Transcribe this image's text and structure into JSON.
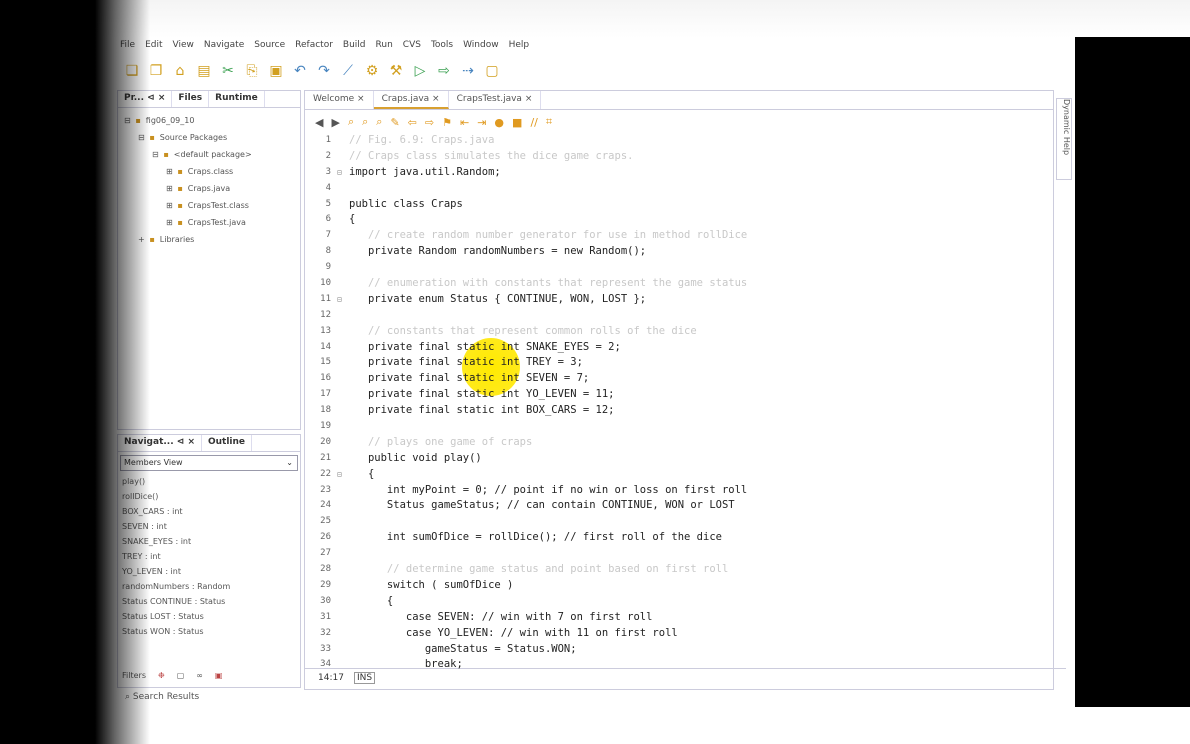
{
  "menu": [
    "File",
    "Edit",
    "View",
    "Navigate",
    "Source",
    "Refactor",
    "Build",
    "Run",
    "CVS",
    "Tools",
    "Window",
    "Help"
  ],
  "projects_panel": {
    "tabs": [
      "Pr... ⊲ ×",
      "Files",
      "Runtime"
    ],
    "tree": [
      {
        "indent": 0,
        "label": "fig06_09_10"
      },
      {
        "indent": 1,
        "label": "Source Packages"
      },
      {
        "indent": 2,
        "label": "<default package>"
      },
      {
        "indent": 3,
        "label": "Craps.class"
      },
      {
        "indent": 3,
        "label": "Craps.java"
      },
      {
        "indent": 3,
        "label": "CrapsTest.class"
      },
      {
        "indent": 3,
        "label": "CrapsTest.java"
      },
      {
        "indent": 1,
        "label": "Libraries"
      }
    ]
  },
  "navigator_panel": {
    "tabs": [
      "Navigat... ⊲ ×",
      "Outline"
    ],
    "view": "Members View",
    "members": [
      "play()",
      "rollDice()",
      "BOX_CARS : int",
      "SEVEN : int",
      "SNAKE_EYES : int",
      "TREY : int",
      "YO_LEVEN : int",
      "randomNumbers : Random",
      "Status CONTINUE : Status",
      "Status LOST : Status",
      "Status WON : Status"
    ],
    "filters_label": "Filters"
  },
  "editor": {
    "tabs": [
      "Welcome ×",
      "Craps.java ×",
      "CrapsTest.java ×"
    ],
    "lines": [
      {
        "n": "1",
        "g": "",
        "t": "// Fig. 6.9: Craps.java",
        "c": "comment"
      },
      {
        "n": "2",
        "g": "",
        "t": "// Craps class simulates the dice game craps.",
        "c": "comment"
      },
      {
        "n": "3",
        "g": "⊟",
        "t": "import java.util.Random;",
        "c": "txt"
      },
      {
        "n": "4",
        "g": "",
        "t": "",
        "c": "txt"
      },
      {
        "n": "5",
        "g": "",
        "t": "public class Craps",
        "c": "txt"
      },
      {
        "n": "6",
        "g": "",
        "t": "{",
        "c": "txt"
      },
      {
        "n": "7",
        "g": "",
        "t": "   // create random number generator for use in method rollDice",
        "c": "comment"
      },
      {
        "n": "8",
        "g": "",
        "t": "   private Random randomNumbers = new Random();",
        "c": "txt"
      },
      {
        "n": "9",
        "g": "",
        "t": "",
        "c": "txt"
      },
      {
        "n": "10",
        "g": "",
        "t": "   // enumeration with constants that represent the game status",
        "c": "comment"
      },
      {
        "n": "11",
        "g": "⊟",
        "t": "   private enum Status { CONTINUE, WON, LOST };",
        "c": "txt"
      },
      {
        "n": "12",
        "g": "",
        "t": "",
        "c": "txt"
      },
      {
        "n": "13",
        "g": "",
        "t": "   // constants that represent common rolls of the dice",
        "c": "comment"
      },
      {
        "n": "14",
        "g": "",
        "t": "   private final static int SNAKE_EYES = 2;",
        "c": "txt"
      },
      {
        "n": "15",
        "g": "",
        "t": "   private final static int TREY = 3;",
        "c": "txt"
      },
      {
        "n": "16",
        "g": "",
        "t": "   private final static int SEVEN = 7;",
        "c": "txt"
      },
      {
        "n": "17",
        "g": "",
        "t": "   private final static int YO_LEVEN = 11;",
        "c": "txt"
      },
      {
        "n": "18",
        "g": "",
        "t": "   private final static int BOX_CARS = 12;",
        "c": "txt"
      },
      {
        "n": "19",
        "g": "",
        "t": "",
        "c": "txt"
      },
      {
        "n": "20",
        "g": "",
        "t": "   // plays one game of craps",
        "c": "comment"
      },
      {
        "n": "21",
        "g": "",
        "t": "   public void play()",
        "c": "txt"
      },
      {
        "n": "22",
        "g": "⊟",
        "t": "   {",
        "c": "txt"
      },
      {
        "n": "23",
        "g": "",
        "t": "      int myPoint = 0; // point if no win or loss on first roll",
        "c": "txt"
      },
      {
        "n": "24",
        "g": "",
        "t": "      Status gameStatus; // can contain CONTINUE, WON or LOST",
        "c": "txt"
      },
      {
        "n": "25",
        "g": "",
        "t": "",
        "c": "txt"
      },
      {
        "n": "26",
        "g": "",
        "t": "      int sumOfDice = rollDice(); // first roll of the dice",
        "c": "txt"
      },
      {
        "n": "27",
        "g": "",
        "t": "",
        "c": "txt"
      },
      {
        "n": "28",
        "g": "",
        "t": "      // determine game status and point based on first roll",
        "c": "comment"
      },
      {
        "n": "29",
        "g": "",
        "t": "      switch ( sumOfDice )",
        "c": "txt"
      },
      {
        "n": "30",
        "g": "",
        "t": "      {",
        "c": "txt"
      },
      {
        "n": "31",
        "g": "",
        "t": "         case SEVEN: // win with 7 on first roll",
        "c": "txt"
      },
      {
        "n": "32",
        "g": "",
        "t": "         case YO_LEVEN: // win with 11 on first roll",
        "c": "txt"
      },
      {
        "n": "33",
        "g": "",
        "t": "            gameStatus = Status.WON;",
        "c": "txt"
      },
      {
        "n": "34",
        "g": "",
        "t": "            break;",
        "c": "txt"
      }
    ]
  },
  "status": {
    "position": "14:17",
    "mode": "INS"
  },
  "bottom": {
    "label": "Search Results"
  },
  "side_tab": "Dynamic Help"
}
